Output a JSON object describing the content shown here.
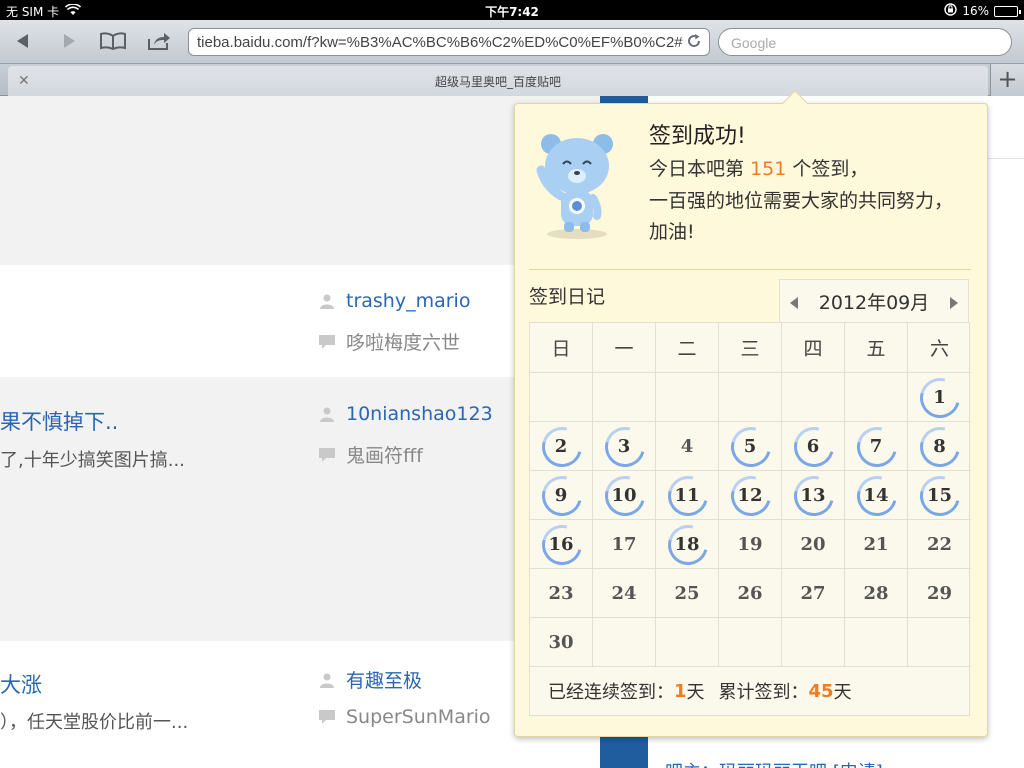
{
  "status_bar": {
    "carrier": "无 SIM 卡",
    "time": "下午7:42",
    "battery": "16%",
    "battery_level": 0.16
  },
  "browser": {
    "url": "tieba.baidu.com/f?kw=%B3%AC%BC%B6%C2%ED%C0%EF%B0%C2#",
    "search_placeholder": "Google",
    "tab_title": "超级马里奥吧_百度贴吧"
  },
  "threads": [
    {
      "title": "",
      "excerpt": "",
      "author": "trashy_mario",
      "last_reply": "哆啦梅度六世"
    },
    {
      "title": "果不慎掉下..",
      "excerpt": "了,十年少搞笑图片搞...",
      "author": "10nianshao123",
      "last_reply": "鬼画符fff"
    },
    {
      "title": "大涨",
      "excerpt": "），任天堂股价比前一...",
      "author": "有趣至极",
      "last_reply": "SuperSunMario"
    }
  ],
  "footer_partial_text": "吧主：玛丽玛丽玉吧 [申请]",
  "signin_popup": {
    "title": "签到成功!",
    "line1_prefix": "今日本吧第",
    "rank": "151",
    "line1_suffix": "个签到，",
    "line2": "一百强的地位需要大家的共同努力，",
    "line3": "加油!",
    "diary_label": "签到日记",
    "month": "2012年09月",
    "weekdays": [
      "日",
      "一",
      "二",
      "三",
      "四",
      "五",
      "六"
    ],
    "first_weekday_index": 6,
    "days_in_month": 30,
    "signed_days": [
      1,
      2,
      3,
      5,
      6,
      7,
      8,
      9,
      10,
      11,
      12,
      13,
      14,
      15,
      16,
      18
    ],
    "streak_label": "已经连续签到：",
    "streak_days": "1",
    "streak_unit": "天",
    "total_label": "累计签到：",
    "total_days": "45",
    "total_unit": "天"
  },
  "colors": {
    "link_blue": "#2a66b3",
    "accent_orange": "#f27c1d",
    "popup_bg": "#fff9dc",
    "ring_blue": "#7aa7e6"
  }
}
